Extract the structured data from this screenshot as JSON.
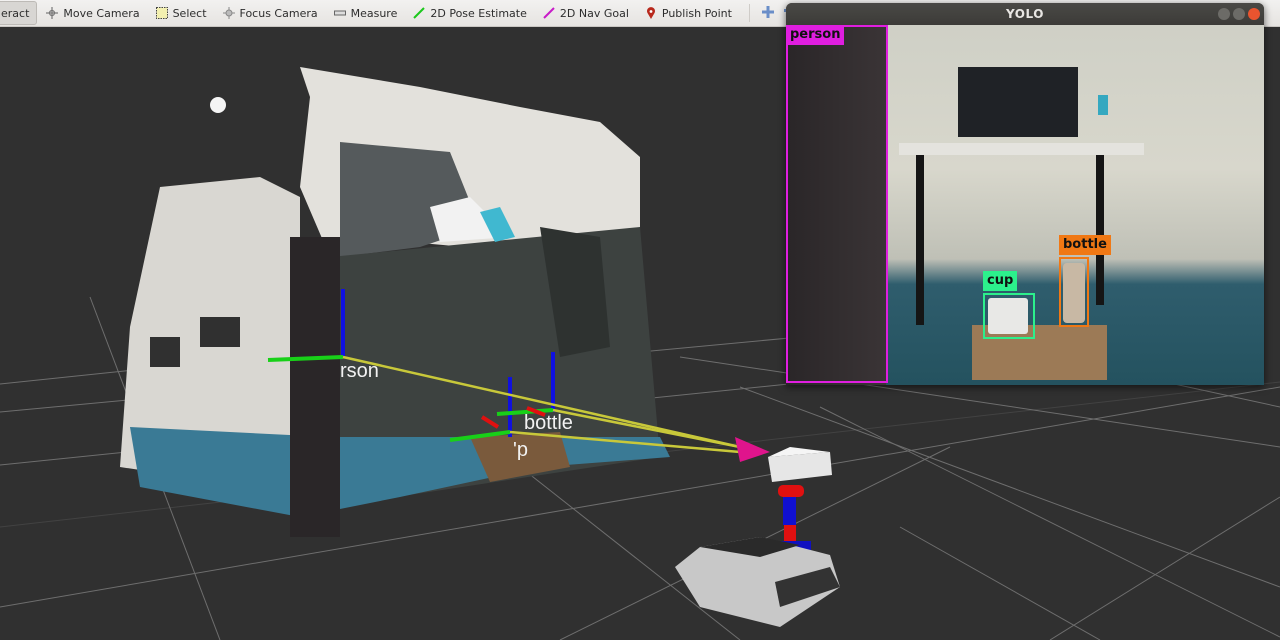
{
  "toolbar": {
    "items": [
      {
        "label": "eract",
        "icon": "interact-icon",
        "active": true
      },
      {
        "label": "Move Camera",
        "icon": "move-camera-icon"
      },
      {
        "label": "Select",
        "icon": "select-icon"
      },
      {
        "label": "Focus Camera",
        "icon": "focus-camera-icon"
      },
      {
        "label": "Measure",
        "icon": "measure-icon"
      },
      {
        "label": "2D Pose Estimate",
        "icon": "pose-estimate-icon"
      },
      {
        "label": "2D Nav Goal",
        "icon": "nav-goal-icon"
      },
      {
        "label": "Publish Point",
        "icon": "publish-point-icon"
      }
    ],
    "extra_icons": [
      "add-tool-icon",
      "remove-tool-icon",
      "view-options-icon"
    ]
  },
  "scene": {
    "markers": [
      {
        "label": "rson"
      },
      {
        "label": "bottle"
      },
      {
        "label": "'p"
      }
    ],
    "colors": {
      "background": "#303030",
      "grid": "#6e6e6e",
      "ray": "#c8c83a",
      "axis_x": "#e01010",
      "axis_y": "#18d018",
      "axis_z": "#1010e0",
      "arrow": "#e0148c"
    }
  },
  "yolo_window": {
    "title": "YOLO",
    "detections": [
      {
        "label": "person",
        "color": "#e01ee0"
      },
      {
        "label": "cup",
        "color": "#2cf08c"
      },
      {
        "label": "bottle",
        "color": "#f07814"
      }
    ]
  }
}
